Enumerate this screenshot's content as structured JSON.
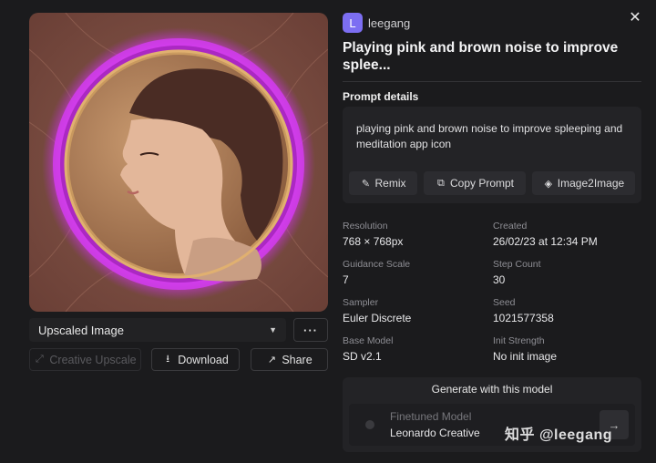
{
  "user": {
    "avatar_letter": "L",
    "name": "leegang"
  },
  "title": "Playing pink and brown noise to improve splee...",
  "prompt_section": {
    "label": "Prompt details",
    "text": "playing pink and brown noise to improve spleeping and meditation app icon",
    "buttons": {
      "remix": "Remix",
      "copy": "Copy Prompt",
      "image2image": "Image2Image"
    }
  },
  "left_controls": {
    "select_value": "Upscaled Image",
    "more": "···",
    "creative_upscale": "Creative Upscale",
    "download": "Download",
    "share": "Share"
  },
  "details": {
    "resolution": {
      "label": "Resolution",
      "value": "768 × 768px"
    },
    "created": {
      "label": "Created",
      "value": "26/02/23 at 12:34 PM"
    },
    "guidance_scale": {
      "label": "Guidance Scale",
      "value": "7"
    },
    "step_count": {
      "label": "Step Count",
      "value": "30"
    },
    "sampler": {
      "label": "Sampler",
      "value": "Euler Discrete"
    },
    "seed": {
      "label": "Seed",
      "value": "1021577358"
    },
    "base_model": {
      "label": "Base Model",
      "value": "SD v2.1"
    },
    "init_strength": {
      "label": "Init Strength",
      "value": "No init image"
    }
  },
  "generate": {
    "title": "Generate with this model",
    "model_type": "Finetuned Model",
    "model_name": "Leonardo Creative"
  },
  "watermark": "知乎 @leegang",
  "colors": {
    "background": "#1b1b1d",
    "panel": "#232326",
    "avatar": "#7c6ef2",
    "accent_magenta": "#d23cf0"
  },
  "icons": [
    "close-icon",
    "chevron-down-icon",
    "more-icon",
    "expand-icon",
    "download-icon",
    "share-icon",
    "remix-icon",
    "copy-icon",
    "layers-icon",
    "arrow-right-icon"
  ]
}
